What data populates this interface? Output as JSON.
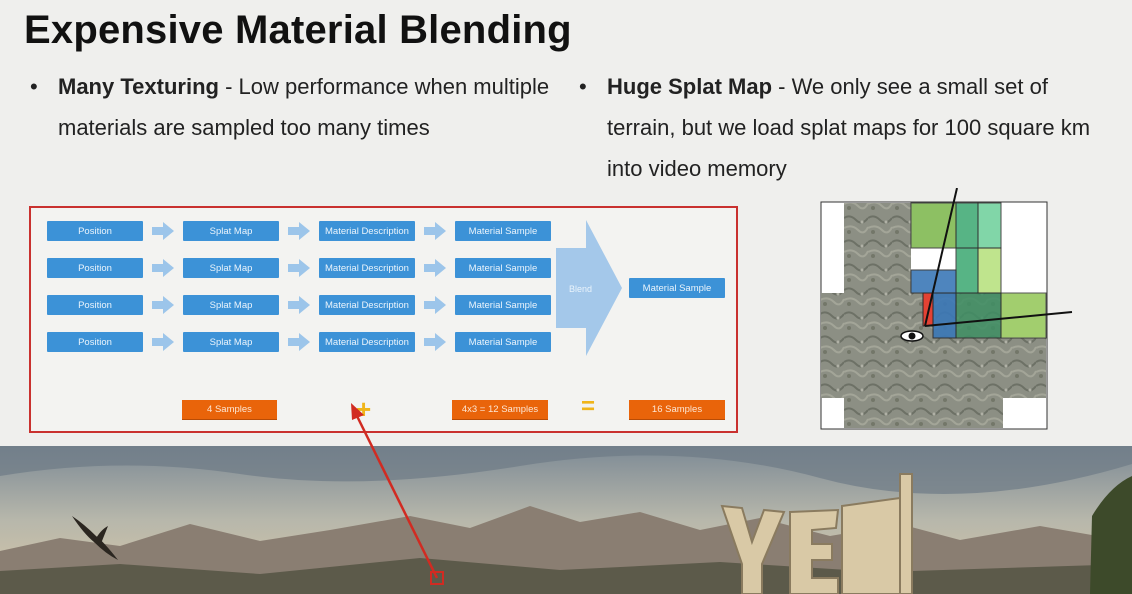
{
  "slide": {
    "title": "Expensive Material Blending",
    "bullets": [
      {
        "heading": "Many Texturing",
        "text": " - Low performance when multiple materials are sampled too many times"
      },
      {
        "heading": "Huge Splat Map",
        "text": " - We only see a small set of terrain, but we load splat maps for 100 square km into video memory"
      }
    ]
  },
  "diagram": {
    "rows": [
      [
        "Position",
        "Splat Map",
        "Material Description",
        "Material Sample"
      ],
      [
        "Position",
        "Splat Map",
        "Material Description",
        "Material Sample"
      ],
      [
        "Position",
        "Splat Map",
        "Material Description",
        "Material Sample"
      ],
      [
        "Position",
        "Splat Map",
        "Material Description",
        "Material Sample"
      ]
    ],
    "blend_label": "Blend",
    "output_label": "Material Sample",
    "sample_counts": {
      "first": "4 Samples",
      "second": "4x3 = 12 Samples",
      "total": "16 Samples"
    },
    "plus_symbol": "+",
    "equals_symbol": "=",
    "colors": {
      "box": "#3c92d7",
      "arrow": "#9cc5ea",
      "orange": "#e9640a",
      "border": "#c9312f"
    }
  }
}
